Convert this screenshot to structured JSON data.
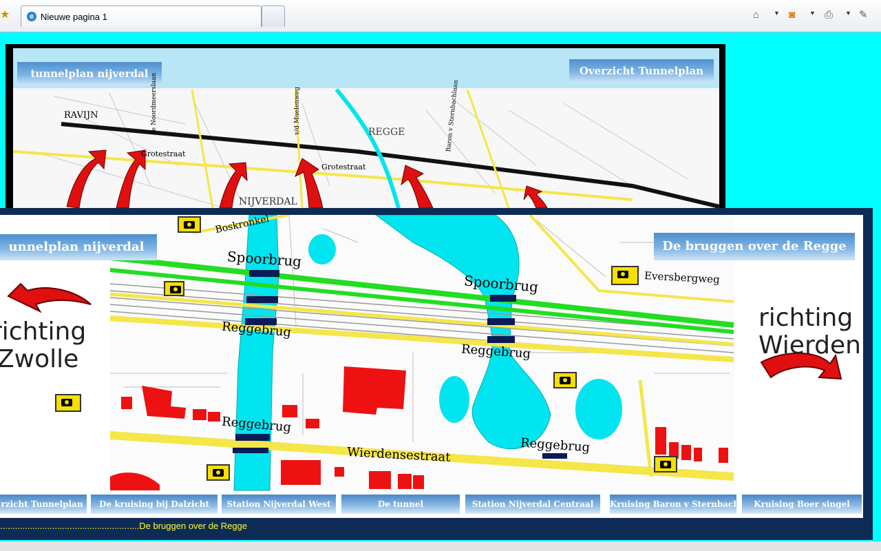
{
  "browser": {
    "tab_title": "Nieuwe pagina 1"
  },
  "top_page": {
    "title": "tunnelplan nijverdal",
    "overview_button": "Overzicht Tunnelplan",
    "map_labels": {
      "ravijn": "RAVIJN",
      "grotestraat1": "Grotestraat",
      "grotestraat2": "Grotestraat",
      "regge": "REGGE",
      "nijverdal": "NIJVERDAL",
      "weg1": "de Noordmeerslaan",
      "weg2": "v/d Muelenweg",
      "weg3": "Baron v Sternbachlaan"
    }
  },
  "front_page": {
    "title": "unnelplan nijverdal",
    "section_heading": "De bruggen over de Regge",
    "left_direction": "richting\nZwolle",
    "right_direction": "richting\nWierden",
    "map_labels": {
      "boskronkel": "Boskronkel",
      "spoorbrug1": "Spoorbrug",
      "spoorbrug2": "Spoorbrug",
      "reggebrug1": "Reggebrug",
      "reggebrug2": "Reggebrug",
      "reggebrug3": "Reggebrug",
      "reggebrug4": "Reggebrug",
      "eversbergweg": "Eversbergweg",
      "wierdensestraat": "Wierdensestraat"
    },
    "nav_buttons": [
      "rzicht Tunnelplan",
      "De kruising bij Dalzicht",
      "Station Nijverdal West",
      "De tunnel",
      "Station Nijverdal Centraal",
      "Kruising Baron v Sternbach",
      "Kruising Boer singel"
    ],
    "status_text": "........................................................De bruggen over de Regge"
  },
  "colors": {
    "page_background": "#00ffff",
    "frame": "#0e2b55",
    "water": "#00e5f0",
    "rail_green": "#22dd22",
    "road_yellow": "#f5e64a",
    "buildings": "#ee1111",
    "status_text": "#ffff33"
  },
  "icons": [
    "favorites-star-icon",
    "ie-page-icon",
    "home-icon",
    "feeds-icon",
    "print-icon",
    "page-icon",
    "camera-icon"
  ]
}
